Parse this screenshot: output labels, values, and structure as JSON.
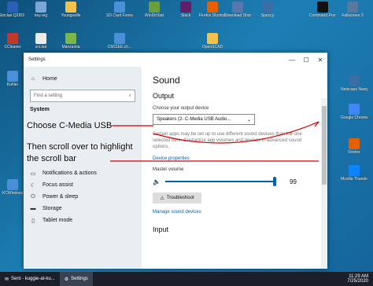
{
  "desktop_icons": [
    {
      "label": "Sinclair\nQ2ID2 cebl...",
      "color": "#2b5fb3"
    },
    {
      "label": "key.reg",
      "color": "#7aa7d6"
    },
    {
      "label": "Youngsville",
      "color": "#f2c14e"
    },
    {
      "label": "SD Card Formatter",
      "color": "#4a90d9"
    },
    {
      "label": "WinDirStat",
      "color": "#6a9f3b"
    },
    {
      "label": "Slack",
      "color": "#611f69"
    },
    {
      "label": "Firefox Shortcut",
      "color": "#e66000"
    },
    {
      "label": "Download Shortcut",
      "color": "#5577aa"
    },
    {
      "label": "Speccy",
      "color": "#3a6ea5"
    },
    {
      "label": "Command Prompt",
      "color": "#111"
    },
    {
      "label": "Fallscreen 3",
      "color": "#5a79a1"
    },
    {
      "label": "CCleaner",
      "color": "#c0392b"
    },
    {
      "label": "sni.dat",
      "color": "#ececec"
    },
    {
      "label": "Manzanita",
      "color": "#7ab648"
    },
    {
      "label": "CM11EE.ch...",
      "color": "#4a90d9"
    },
    {
      "label": "OpenSCAD",
      "color": "#f2c14e"
    },
    {
      "label": "Netscape Navigator",
      "color": "#3a6ea5"
    },
    {
      "label": "Kohler",
      "color": "#4a90d9"
    },
    {
      "label": "Google Chrome",
      "color": "#4285f4"
    },
    {
      "label": "Firefox",
      "color": "#e66000"
    },
    {
      "label": "Mozilla Thunderbird",
      "color": "#0a84ff"
    },
    {
      "label": "KCWireless",
      "color": "#4a90d9"
    }
  ],
  "window": {
    "title": "Settings",
    "minimize_icon": "—",
    "maximize_icon": "☐",
    "close_icon": "✕"
  },
  "sidebar": {
    "home_label": "Home",
    "search_placeholder": "Find a setting",
    "section": "System",
    "items": [
      {
        "label": "Notifications & actions",
        "icon": "notifications-icon",
        "glyph": "▭"
      },
      {
        "label": "Focus assist",
        "icon": "focus-assist-icon",
        "glyph": "☾"
      },
      {
        "label": "Power & sleep",
        "icon": "power-icon",
        "glyph": "⏻"
      },
      {
        "label": "Storage",
        "icon": "storage-icon",
        "glyph": "▬"
      },
      {
        "label": "Tablet mode",
        "icon": "tablet-icon",
        "glyph": "▯"
      }
    ]
  },
  "main": {
    "title": "Sound",
    "output_heading": "Output",
    "output_device_label": "Choose your output device",
    "output_device_value": "Speakers (2- C-Media USB Audio...",
    "description": "Certain apps may be set up to use different sound devices than the one selected here. Customize app volumes and devices in advanced sound options.",
    "device_properties_link": "Device properties",
    "master_volume_label": "Master volume",
    "volume_value": "99",
    "volume_fraction": 0.99,
    "troubleshoot_label": "Troubleshoot",
    "manage_devices_link": "Manage sound devices",
    "input_heading": "Input"
  },
  "annotations": {
    "step1": "Choose C-Media USB",
    "step2_line1": "Then scroll over to highlight",
    "step2_line2": "the scroll bar",
    "color": "#d40000"
  },
  "taskbar": {
    "task1_label": "Sent - kuggie-at-ku...",
    "task2_label": "Settings",
    "time": "11:29 AM",
    "date": "7/25/2020"
  }
}
